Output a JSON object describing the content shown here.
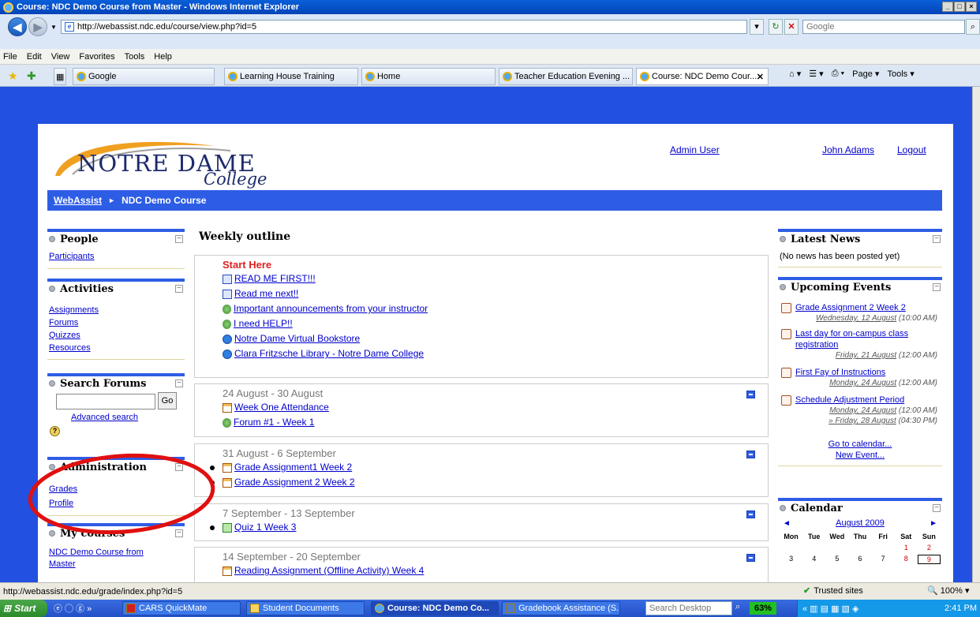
{
  "browser": {
    "window_title": "Course: NDC Demo Course from Master - Windows Internet Explorer",
    "url": "http://webassist.ndc.edu/course/view.php?id=5",
    "search_placeholder": "Google",
    "menu": [
      "File",
      "Edit",
      "View",
      "Favorites",
      "Tools",
      "Help"
    ],
    "tabs": [
      {
        "label": "Google"
      },
      {
        "label": "Learning House Training"
      },
      {
        "label": "Home"
      },
      {
        "label": "Teacher Education Evening ..."
      },
      {
        "label": "Course: NDC Demo Cour..."
      }
    ],
    "commands": [
      "Page",
      "Tools"
    ],
    "status_url": "http://webassist.ndc.edu/grade/index.php?id=5",
    "zone": "Trusted sites",
    "zoom": "100%"
  },
  "header": {
    "logo_main": "NOTRE DAME",
    "logo_sub": "College",
    "admin_link": "Admin User",
    "user_name": "John Adams",
    "logout": "Logout"
  },
  "breadcrumb": {
    "site": "WebAssist",
    "course": "NDC Demo Course"
  },
  "left": {
    "people": {
      "title": "People",
      "items": [
        "Participants"
      ]
    },
    "activities": {
      "title": "Activities",
      "items": [
        "Assignments",
        "Forums",
        "Quizzes",
        "Resources"
      ]
    },
    "search_forums": {
      "title": "Search Forums",
      "go": "Go",
      "advanced": "Advanced search"
    },
    "administration": {
      "title": "Administration",
      "items": [
        "Grades",
        "Profile"
      ]
    },
    "my_courses": {
      "title": "My courses",
      "items": [
        "NDC Demo Course from Master"
      ]
    }
  },
  "main": {
    "title": "Weekly outline",
    "start": {
      "heading": "Start Here",
      "items": [
        "READ ME FIRST!!!",
        "Read me next!!",
        "Important announcements from your instructor",
        "I need HELP!!",
        "Notre Dame Virtual Bookstore",
        "Clara Fritzsche Library - Notre Dame College"
      ]
    },
    "weeks": [
      {
        "dates": "24 August - 30 August",
        "items": [
          "Week One Attendance",
          "Forum #1 - Week 1"
        ]
      },
      {
        "dates": "31 August - 6 September",
        "items": [
          "Grade Assignment1 Week 2",
          "Grade Assignment 2 Week 2"
        ]
      },
      {
        "dates": "7 September - 13 September",
        "items": [
          "Quiz 1 Week 3"
        ]
      },
      {
        "dates": "14 September - 20 September",
        "items": [
          "Reading Assignment (Offline Activity) Week 4"
        ]
      }
    ]
  },
  "right": {
    "news": {
      "title": "Latest News",
      "empty": "(No news has been posted yet)"
    },
    "events": {
      "title": "Upcoming Events",
      "items": [
        {
          "name": "Grade Assignment 2 Week 2",
          "date": "Wednesday, 12 August",
          "time": "(10:00 AM)"
        },
        {
          "name": "Last day for on-campus class registration",
          "date": "Friday, 21 August",
          "time": "(12:00 AM)"
        },
        {
          "name": "First Fay of Instructions",
          "date": "Monday, 24 August",
          "time": "(12:00 AM)"
        },
        {
          "name": "Schedule Adjustment Period",
          "date": "Monday, 24 August",
          "time": "(12:00 AM)",
          "date2": "» Friday, 28 August",
          "time2": "(04:30 PM)"
        }
      ],
      "goto": "Go to calendar...",
      "new": "New Event..."
    },
    "calendar": {
      "title": "Calendar",
      "month": "August 2009",
      "days": [
        "Mon",
        "Tue",
        "Wed",
        "Thu",
        "Fri",
        "Sat",
        "Sun"
      ],
      "dates": [
        "",
        "",
        "",
        "",
        "",
        "1",
        "2",
        "3",
        "4",
        "5",
        "6",
        "7",
        "8",
        "9"
      ],
      "today": "9"
    }
  },
  "taskbar": {
    "start": "Start",
    "items": [
      "CARS QuickMate",
      "Student Documents",
      "Course: NDC Demo Co...",
      "Gradebook Assistance (S..."
    ],
    "search": "Search Desktop",
    "battery": "63%",
    "clock": "2:41 PM"
  }
}
